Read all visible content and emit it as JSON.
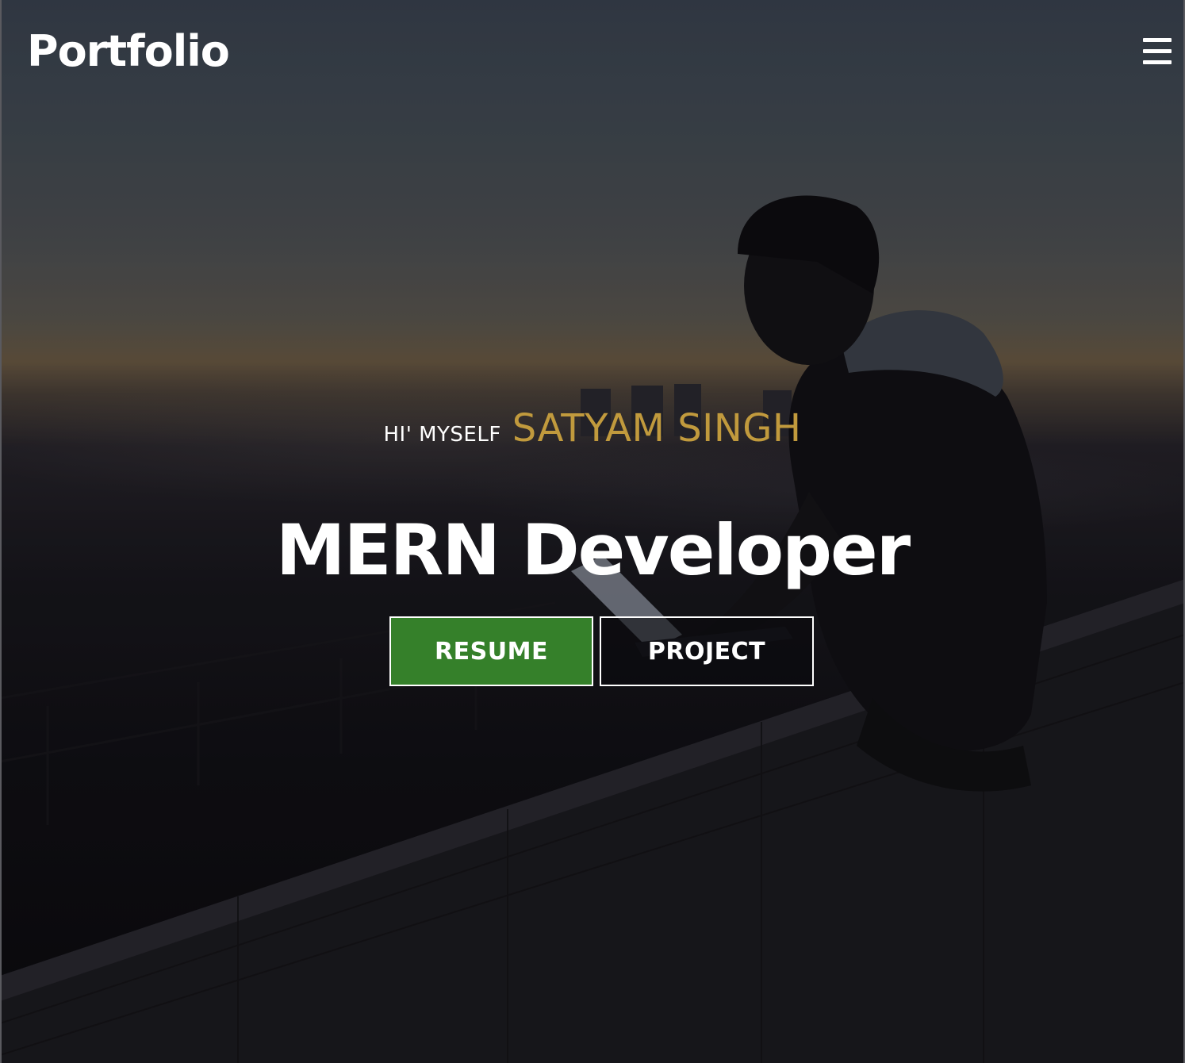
{
  "header": {
    "brand": "Portfolio",
    "menu_icon": "hamburger-menu-icon"
  },
  "hero": {
    "greeting": "HI' MYSELF",
    "name": "SATYAM SINGH",
    "role": "MERN Developer",
    "background_image": "silhouette of a person using a laptop on a ledge overlooking a city at dusk"
  },
  "actions": {
    "resume_label": "RESUME",
    "project_label": "PROJECT"
  },
  "colors": {
    "accent_gold": "#c19a3d",
    "resume_green": "#35802a",
    "text": "#ffffff"
  }
}
